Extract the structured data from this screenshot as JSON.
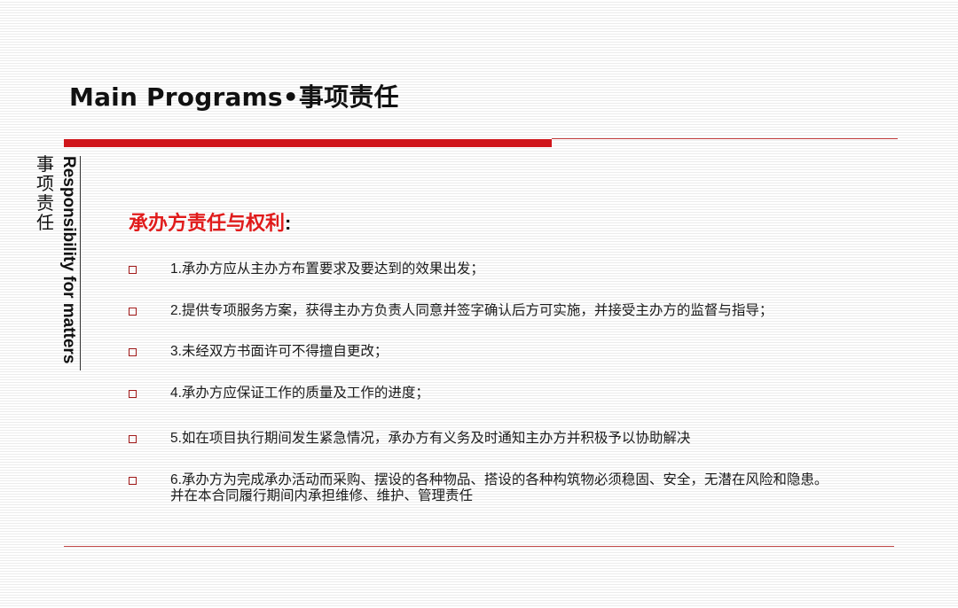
{
  "title": "Main  Programs•事项责任",
  "sidebar": {
    "chinese_chars": [
      "事",
      "项",
      "责",
      "任"
    ],
    "english": "Responsibility for matters"
  },
  "section": {
    "heading": "承办方责任与权利",
    "heading_colon": ":"
  },
  "items": [
    {
      "lines": [
        "1.承办方应从主办方布置要求及要达到的效果出发；"
      ]
    },
    {
      "lines": [
        "2.提供专项服务方案，获得主办方负责人同意并签字确认后方可实施，并接受主办方的监督与指导；"
      ]
    },
    {
      "lines": [
        "3.未经双方书面许可不得擅自更改；"
      ]
    },
    {
      "lines": [
        "4.承办方应保证工作的质量及工作的进度；"
      ]
    },
    {
      "lines": [
        "5.如在项目执行期间发生紧急情况，承办方有义务及时通知主办方并积极予以协助解决"
      ]
    },
    {
      "lines": [
        "6.承办方为完成承办活动而采购、摆设的各种物品、搭设的各种构筑物必须稳固、安全，无潜在风险和隐患。",
        "并在本合同履行期间内承担维修、维护、管理责任"
      ]
    }
  ],
  "colors": {
    "accent_red": "#d0161b",
    "heading_red": "#e01b1b",
    "bullet_red": "#a01818"
  }
}
